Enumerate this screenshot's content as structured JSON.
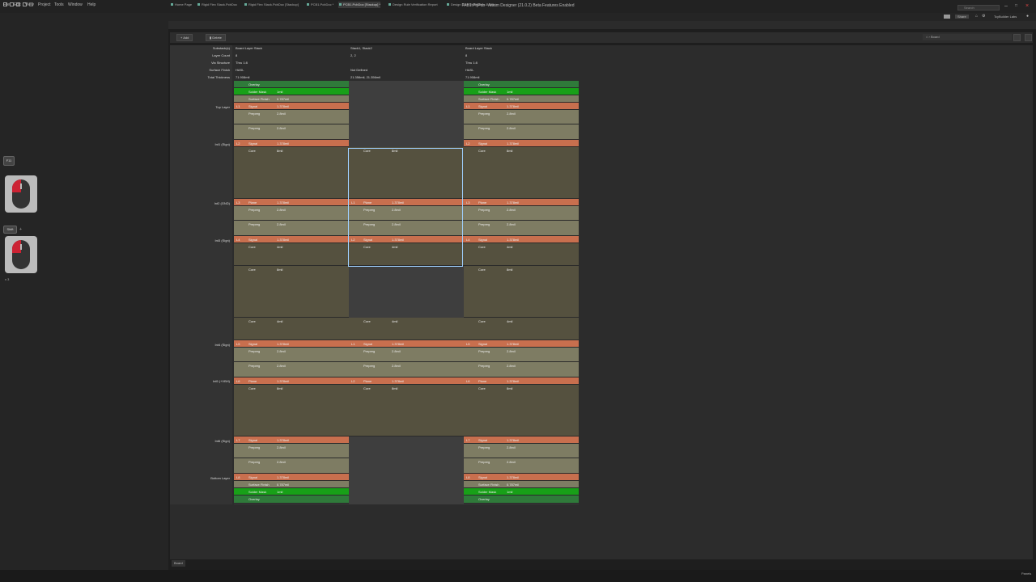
{
  "window": {
    "title": "FAB1.PrjPcb - Altium Designer (21.0.2) Beta Features Enabled",
    "search_placeholder": "Search",
    "share_label": "Share",
    "user": "TcyBuilder Labs"
  },
  "menu": [
    "File",
    "Edit",
    "View",
    "Project",
    "Tools",
    "Window",
    "Help"
  ],
  "tabs": [
    "Home Page",
    "Rigid Flex Stack.PcbDoc",
    "Rigid Flex Stack.PcbDoc [Stackup]",
    "PCB1.PcbDoc *",
    "PCB1.PcbDoc [Stackup] *",
    "Design Rule Verification Report",
    "Design Rule Verification Report"
  ],
  "toolbar": {
    "add": "Add",
    "delete": "Delete",
    "breadcrumb": "Board"
  },
  "props": {
    "labels": [
      "Substack(s)",
      "Layer Count",
      "Via Structure",
      "Surface Finish",
      "Total Thickness"
    ],
    "stack1": [
      "Board Layer Stack",
      "8",
      "Thru 1:8",
      "HASL",
      "71.908mil"
    ],
    "stack2": [
      "Stack1, Stack2",
      "2, 2",
      "",
      "Not Defined",
      "21.356mil, 21.356mil"
    ],
    "stack3": [
      "Board Layer Stack",
      "8",
      "Thru 1:8",
      "HASL",
      "71.908mil"
    ]
  },
  "layer_names": [
    "Top Layer",
    "Int1 (Sign)",
    "Int2 (GND)",
    "Int3 (Sign)",
    "Int4 (Sign)",
    "Int5 (+VBH)",
    "Int6 (Sign)",
    "Bottom Layer"
  ],
  "rows": {
    "overlay": "Overlay",
    "solder": "Solder Mask",
    "solder_t": "1mil",
    "surface": "Surface Finish",
    "surface_t": "0.787mil",
    "signal": "Signal",
    "plane": "Plane",
    "prepreg": "Prepreg",
    "core": "Core",
    "cu": "1.378mil",
    "pp": "2.8mil",
    "core8": "8mil",
    "core4": "4mil",
    "L1": "L1",
    "L2": "L2",
    "L3": "L3",
    "L4": "L4",
    "L5": "L5",
    "L6": "L6",
    "L7": "L7",
    "L8": "L8"
  },
  "overlay": {
    "key_f11": "F11",
    "key_shift": "Shift",
    "plus": "+",
    "times": "x 3"
  },
  "status": {
    "panels": "Panels",
    "board_tab": "Board"
  }
}
